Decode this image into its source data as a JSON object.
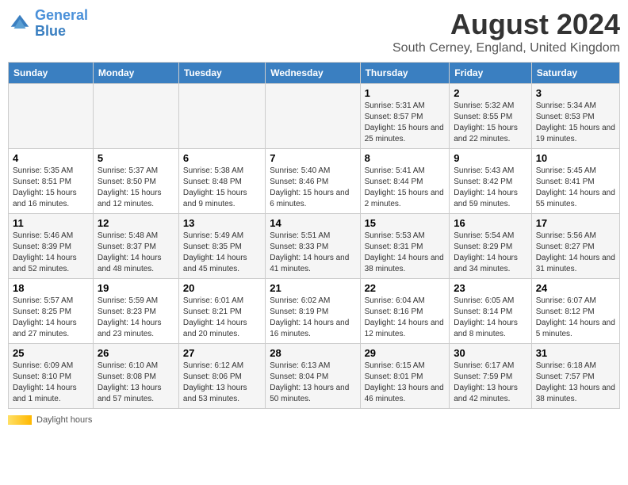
{
  "logo": {
    "line1": "General",
    "line2": "Blue"
  },
  "title": "August 2024",
  "subtitle": "South Cerney, England, United Kingdom",
  "days_of_week": [
    "Sunday",
    "Monday",
    "Tuesday",
    "Wednesday",
    "Thursday",
    "Friday",
    "Saturday"
  ],
  "weeks": [
    [
      {
        "day": "",
        "sunrise": "",
        "sunset": "",
        "daylight": ""
      },
      {
        "day": "",
        "sunrise": "",
        "sunset": "",
        "daylight": ""
      },
      {
        "day": "",
        "sunrise": "",
        "sunset": "",
        "daylight": ""
      },
      {
        "day": "",
        "sunrise": "",
        "sunset": "",
        "daylight": ""
      },
      {
        "day": "1",
        "sunrise": "Sunrise: 5:31 AM",
        "sunset": "Sunset: 8:57 PM",
        "daylight": "Daylight: 15 hours and 25 minutes."
      },
      {
        "day": "2",
        "sunrise": "Sunrise: 5:32 AM",
        "sunset": "Sunset: 8:55 PM",
        "daylight": "Daylight: 15 hours and 22 minutes."
      },
      {
        "day": "3",
        "sunrise": "Sunrise: 5:34 AM",
        "sunset": "Sunset: 8:53 PM",
        "daylight": "Daylight: 15 hours and 19 minutes."
      }
    ],
    [
      {
        "day": "4",
        "sunrise": "Sunrise: 5:35 AM",
        "sunset": "Sunset: 8:51 PM",
        "daylight": "Daylight: 15 hours and 16 minutes."
      },
      {
        "day": "5",
        "sunrise": "Sunrise: 5:37 AM",
        "sunset": "Sunset: 8:50 PM",
        "daylight": "Daylight: 15 hours and 12 minutes."
      },
      {
        "day": "6",
        "sunrise": "Sunrise: 5:38 AM",
        "sunset": "Sunset: 8:48 PM",
        "daylight": "Daylight: 15 hours and 9 minutes."
      },
      {
        "day": "7",
        "sunrise": "Sunrise: 5:40 AM",
        "sunset": "Sunset: 8:46 PM",
        "daylight": "Daylight: 15 hours and 6 minutes."
      },
      {
        "day": "8",
        "sunrise": "Sunrise: 5:41 AM",
        "sunset": "Sunset: 8:44 PM",
        "daylight": "Daylight: 15 hours and 2 minutes."
      },
      {
        "day": "9",
        "sunrise": "Sunrise: 5:43 AM",
        "sunset": "Sunset: 8:42 PM",
        "daylight": "Daylight: 14 hours and 59 minutes."
      },
      {
        "day": "10",
        "sunrise": "Sunrise: 5:45 AM",
        "sunset": "Sunset: 8:41 PM",
        "daylight": "Daylight: 14 hours and 55 minutes."
      }
    ],
    [
      {
        "day": "11",
        "sunrise": "Sunrise: 5:46 AM",
        "sunset": "Sunset: 8:39 PM",
        "daylight": "Daylight: 14 hours and 52 minutes."
      },
      {
        "day": "12",
        "sunrise": "Sunrise: 5:48 AM",
        "sunset": "Sunset: 8:37 PM",
        "daylight": "Daylight: 14 hours and 48 minutes."
      },
      {
        "day": "13",
        "sunrise": "Sunrise: 5:49 AM",
        "sunset": "Sunset: 8:35 PM",
        "daylight": "Daylight: 14 hours and 45 minutes."
      },
      {
        "day": "14",
        "sunrise": "Sunrise: 5:51 AM",
        "sunset": "Sunset: 8:33 PM",
        "daylight": "Daylight: 14 hours and 41 minutes."
      },
      {
        "day": "15",
        "sunrise": "Sunrise: 5:53 AM",
        "sunset": "Sunset: 8:31 PM",
        "daylight": "Daylight: 14 hours and 38 minutes."
      },
      {
        "day": "16",
        "sunrise": "Sunrise: 5:54 AM",
        "sunset": "Sunset: 8:29 PM",
        "daylight": "Daylight: 14 hours and 34 minutes."
      },
      {
        "day": "17",
        "sunrise": "Sunrise: 5:56 AM",
        "sunset": "Sunset: 8:27 PM",
        "daylight": "Daylight: 14 hours and 31 minutes."
      }
    ],
    [
      {
        "day": "18",
        "sunrise": "Sunrise: 5:57 AM",
        "sunset": "Sunset: 8:25 PM",
        "daylight": "Daylight: 14 hours and 27 minutes."
      },
      {
        "day": "19",
        "sunrise": "Sunrise: 5:59 AM",
        "sunset": "Sunset: 8:23 PM",
        "daylight": "Daylight: 14 hours and 23 minutes."
      },
      {
        "day": "20",
        "sunrise": "Sunrise: 6:01 AM",
        "sunset": "Sunset: 8:21 PM",
        "daylight": "Daylight: 14 hours and 20 minutes."
      },
      {
        "day": "21",
        "sunrise": "Sunrise: 6:02 AM",
        "sunset": "Sunset: 8:19 PM",
        "daylight": "Daylight: 14 hours and 16 minutes."
      },
      {
        "day": "22",
        "sunrise": "Sunrise: 6:04 AM",
        "sunset": "Sunset: 8:16 PM",
        "daylight": "Daylight: 14 hours and 12 minutes."
      },
      {
        "day": "23",
        "sunrise": "Sunrise: 6:05 AM",
        "sunset": "Sunset: 8:14 PM",
        "daylight": "Daylight: 14 hours and 8 minutes."
      },
      {
        "day": "24",
        "sunrise": "Sunrise: 6:07 AM",
        "sunset": "Sunset: 8:12 PM",
        "daylight": "Daylight: 14 hours and 5 minutes."
      }
    ],
    [
      {
        "day": "25",
        "sunrise": "Sunrise: 6:09 AM",
        "sunset": "Sunset: 8:10 PM",
        "daylight": "Daylight: 14 hours and 1 minute."
      },
      {
        "day": "26",
        "sunrise": "Sunrise: 6:10 AM",
        "sunset": "Sunset: 8:08 PM",
        "daylight": "Daylight: 13 hours and 57 minutes."
      },
      {
        "day": "27",
        "sunrise": "Sunrise: 6:12 AM",
        "sunset": "Sunset: 8:06 PM",
        "daylight": "Daylight: 13 hours and 53 minutes."
      },
      {
        "day": "28",
        "sunrise": "Sunrise: 6:13 AM",
        "sunset": "Sunset: 8:04 PM",
        "daylight": "Daylight: 13 hours and 50 minutes."
      },
      {
        "day": "29",
        "sunrise": "Sunrise: 6:15 AM",
        "sunset": "Sunset: 8:01 PM",
        "daylight": "Daylight: 13 hours and 46 minutes."
      },
      {
        "day": "30",
        "sunrise": "Sunrise: 6:17 AM",
        "sunset": "Sunset: 7:59 PM",
        "daylight": "Daylight: 13 hours and 42 minutes."
      },
      {
        "day": "31",
        "sunrise": "Sunrise: 6:18 AM",
        "sunset": "Sunset: 7:57 PM",
        "daylight": "Daylight: 13 hours and 38 minutes."
      }
    ]
  ],
  "footer": {
    "daylight_label": "Daylight hours"
  }
}
